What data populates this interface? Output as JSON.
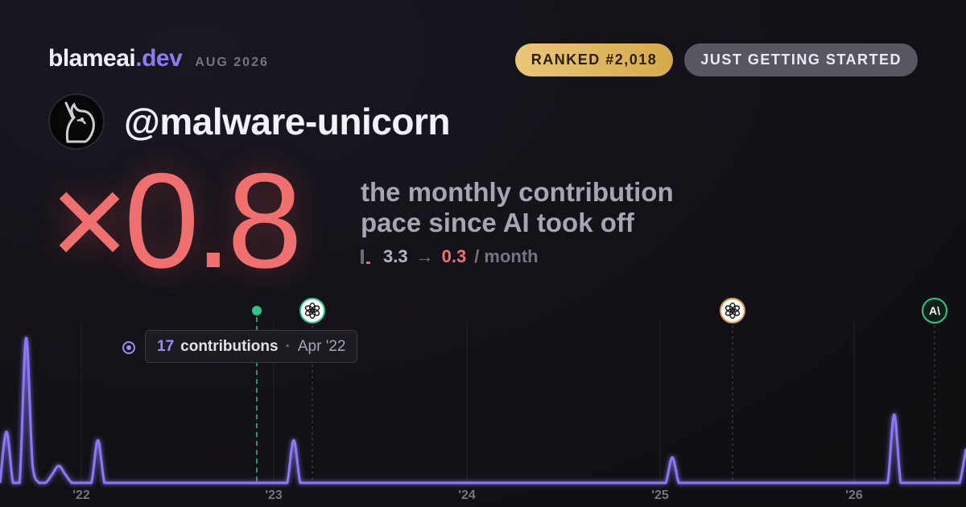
{
  "header": {
    "brand_name": "blameai",
    "brand_tld": ".dev",
    "date": "AUG 2026"
  },
  "badges": {
    "rank": "RANKED #2,018",
    "status": "JUST GETTING STARTED"
  },
  "profile": {
    "handle": "@malware-unicorn"
  },
  "stats": {
    "multiplier": "×0.8",
    "line1": "the monthly contribution",
    "line2": "pace since AI took off",
    "before": "3.3",
    "arrow": "→",
    "after": "0.3",
    "unit": "/ month"
  },
  "tooltip": {
    "count": "17",
    "label": "contributions",
    "separator": "·",
    "when": "Apr '22"
  },
  "colors": {
    "accent": "#8b7cf6",
    "multiplier": "#f07070",
    "release_green": "#2fc48a",
    "release_orange": "#d89a52"
  },
  "chart_data": {
    "type": "area",
    "x_tick_labels": [
      "'22",
      "'23",
      "'24",
      "'25",
      "'26"
    ],
    "series": [
      {
        "values": [
          0,
          6,
          0,
          0,
          17,
          2,
          0,
          0,
          1,
          2,
          1,
          0,
          0,
          0,
          0,
          5,
          0,
          0,
          0,
          0,
          0,
          0,
          0,
          0,
          0,
          0,
          0,
          0,
          0,
          0,
          0,
          0,
          0,
          0,
          0,
          0,
          0,
          0,
          0,
          0,
          0,
          0,
          0,
          0,
          0,
          5,
          0,
          0,
          0,
          0,
          0,
          0,
          0,
          0,
          0,
          0,
          0,
          0,
          0,
          0,
          0,
          0,
          0,
          0,
          0,
          0,
          0,
          0,
          0,
          0,
          0,
          0,
          0,
          0,
          0,
          0,
          0,
          0,
          0,
          0,
          0,
          0,
          0,
          0,
          0,
          0,
          0,
          0,
          0,
          0,
          0,
          0,
          0,
          0,
          0,
          0,
          0,
          0,
          0,
          0,
          0,
          0,
          0,
          3,
          0,
          0,
          0,
          0,
          0,
          0,
          0,
          0,
          0,
          0,
          0,
          0,
          0,
          0,
          0,
          0,
          0,
          0,
          0,
          0,
          0,
          0,
          0,
          0,
          0,
          0,
          0,
          0,
          0,
          0,
          0,
          0,
          0,
          8,
          0,
          0,
          0,
          0,
          0,
          0,
          0,
          0,
          0,
          0,
          4
        ]
      }
    ],
    "grid": "vertical-year-lines",
    "events": [
      {
        "label": "ai-takeoff",
        "x_index": 30,
        "style": "green-dot"
      },
      {
        "label": "openai-release",
        "x_index": 35,
        "icon": "openai-icon",
        "color": "green"
      },
      {
        "label": "openai-release",
        "x_index": 99,
        "icon": "openai-icon",
        "color": "orange"
      },
      {
        "label": "anthropic-release",
        "x_index": 143,
        "icon": "anthropic-icon",
        "color": "green"
      }
    ],
    "highlight": {
      "x_index": 4,
      "value": 17
    }
  }
}
